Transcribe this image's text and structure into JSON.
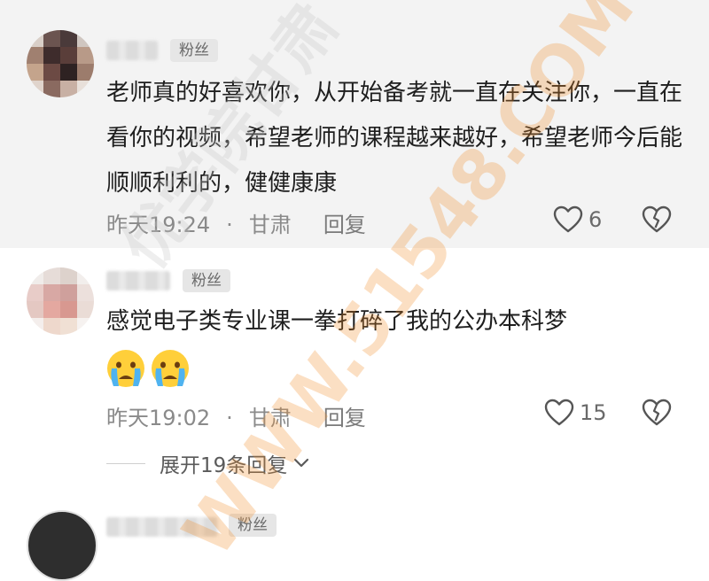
{
  "comments": [
    {
      "badge": "粉丝",
      "content": "老师真的好喜欢你，从开始备考就一直在关注你，一直在看你的视频，希望老师的课程越来越好，希望老师今后能顺顺利利的，健健康康",
      "time": "昨天19:24",
      "separator": "·",
      "location": "甘肃",
      "reply_label": "回复",
      "likes": "6"
    },
    {
      "badge": "粉丝",
      "content": "感觉电子类专业课一拳打碎了我的公办本科梦",
      "emojis": [
        "crying-emoji",
        "crying-emoji"
      ],
      "time": "昨天19:02",
      "separator": "·",
      "location": "甘肃",
      "reply_label": "回复",
      "likes": "15",
      "expand_replies": "展开19条回复"
    },
    {
      "badge": "粉丝"
    }
  ],
  "watermark": {
    "text1": "WWW.51548.COM",
    "text2": "优学院甘肃"
  },
  "colors": {
    "watermark": "#f08c28",
    "badge_bg": "#e6e6e6",
    "highlight_bg": "#f3f3f3"
  }
}
